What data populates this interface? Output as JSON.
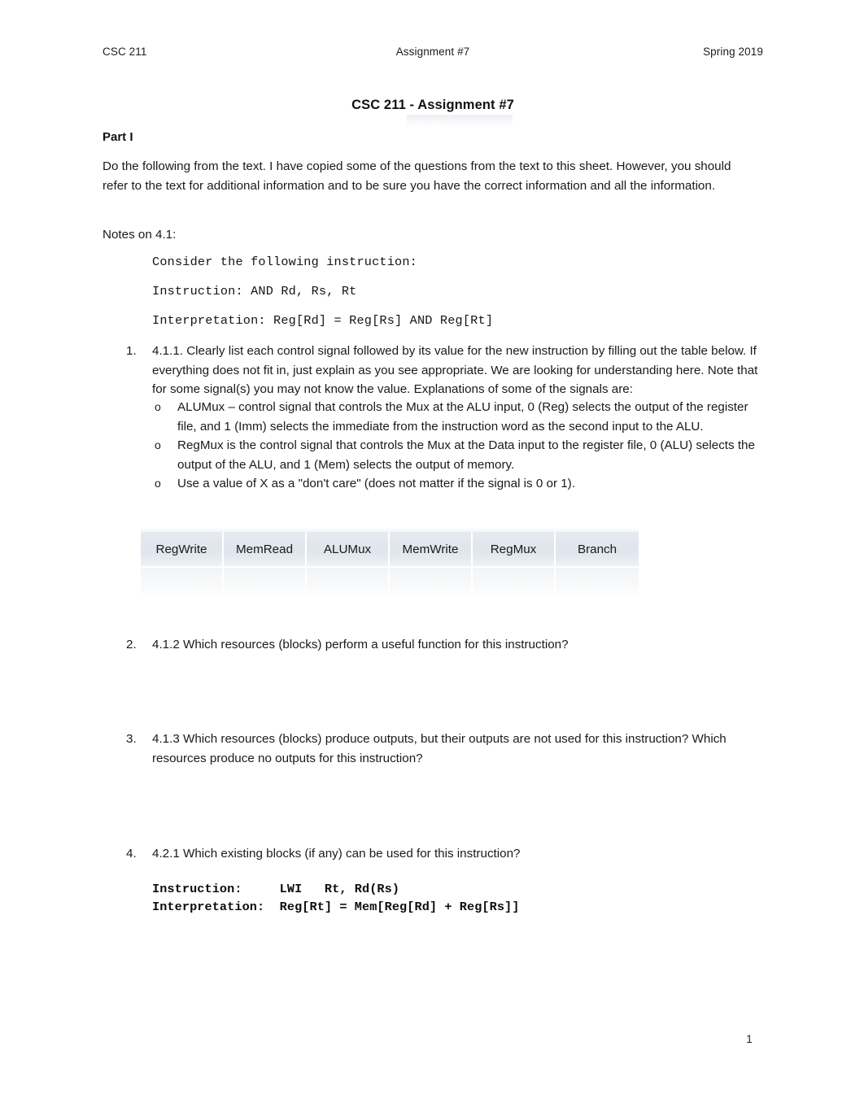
{
  "header": {
    "left": "CSC 211",
    "center": "Assignment #7",
    "right": "Spring 2019"
  },
  "title": "CSC 211 - Assignment #7",
  "part_heading": "Part I",
  "intro_paragraph": "Do the following from the text. I have copied some of the questions from the text to this sheet. However, you should refer to the text for additional information and to be sure you have the correct information and all the information.",
  "notes_label": "Notes on 4.1:",
  "code_block_1": {
    "line1": "Consider the following instruction:",
    "line2": "Instruction: AND Rd, Rs, Rt",
    "line3": "Interpretation: Reg[Rd] = Reg[Rs] AND Reg[Rt]"
  },
  "questions": [
    {
      "number": "1.",
      "text": "4.1.1. Clearly list each control signal followed by its value for the new instruction by filling out the table below. If everything does not fit in, just explain as you see appropriate. We are looking for understanding here. Note that for some signal(s) you may not know the value. Explanations of some of the signals are:"
    },
    {
      "number": "2.",
      "text": "4.1.2 Which resources (blocks) perform a useful function for this instruction?"
    },
    {
      "number": "3.",
      "text": "4.1.3 Which resources (blocks) produce outputs, but their outputs are not used for this instruction? Which resources produce no outputs for this instruction?"
    },
    {
      "number": "4.",
      "text": "4.2.1 Which existing blocks (if any) can be used for this instruction?"
    }
  ],
  "sub_bullets": {
    "marker": "o",
    "items": [
      "ALUMux – control signal that controls the Mux at the ALU input, 0 (Reg) selects the output of the register file, and 1 (Imm) selects the immediate from the instruction word as the second input to the ALU.",
      "RegMux is the control signal that controls the Mux at the Data input to the register file, 0 (ALU) selects the output of the ALU, and 1 (Mem) selects the output of memory.",
      "Use a value of X as a \"don't care\" (does not matter if the signal is 0 or 1)."
    ]
  },
  "signal_table": {
    "headers": [
      "RegWrite",
      "MemRead",
      "ALUMux",
      "MemWrite",
      "RegMux",
      "Branch"
    ],
    "rows": [
      [
        "",
        "",
        "",
        "",
        "",
        ""
      ]
    ],
    "header_fill": "#e0e6ec"
  },
  "code_block_2": {
    "line1": "Instruction:     LWI   Rt, Rd(Rs)",
    "line2": "Interpretation:  Reg[Rt] = Mem[Reg[Rd] + Reg[Rs]]"
  },
  "page_number": "1"
}
